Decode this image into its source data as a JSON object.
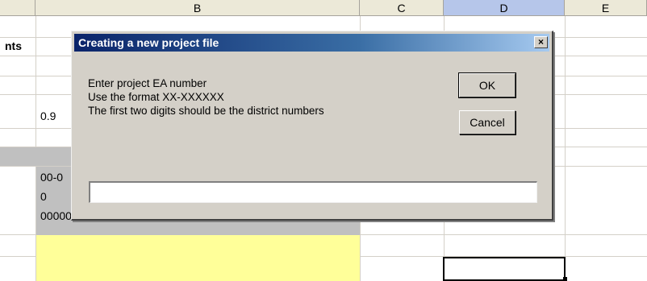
{
  "spreadsheet": {
    "columns": [
      "B",
      "C",
      "D",
      "E"
    ],
    "selected_column": "D",
    "cells": {
      "a2_partial": "nts",
      "b5": "0.9",
      "b8": "00-0",
      "b9": "0",
      "b10": "000000"
    }
  },
  "dialog": {
    "title": "Creating a new project file",
    "close_label": "×",
    "prompt_lines": [
      "Enter project EA number",
      "Use the format XX-XXXXXX",
      "The first two digits should be the district numbers"
    ],
    "ok_label": "OK",
    "cancel_label": "Cancel",
    "input_value": "",
    "input_placeholder": ""
  }
}
